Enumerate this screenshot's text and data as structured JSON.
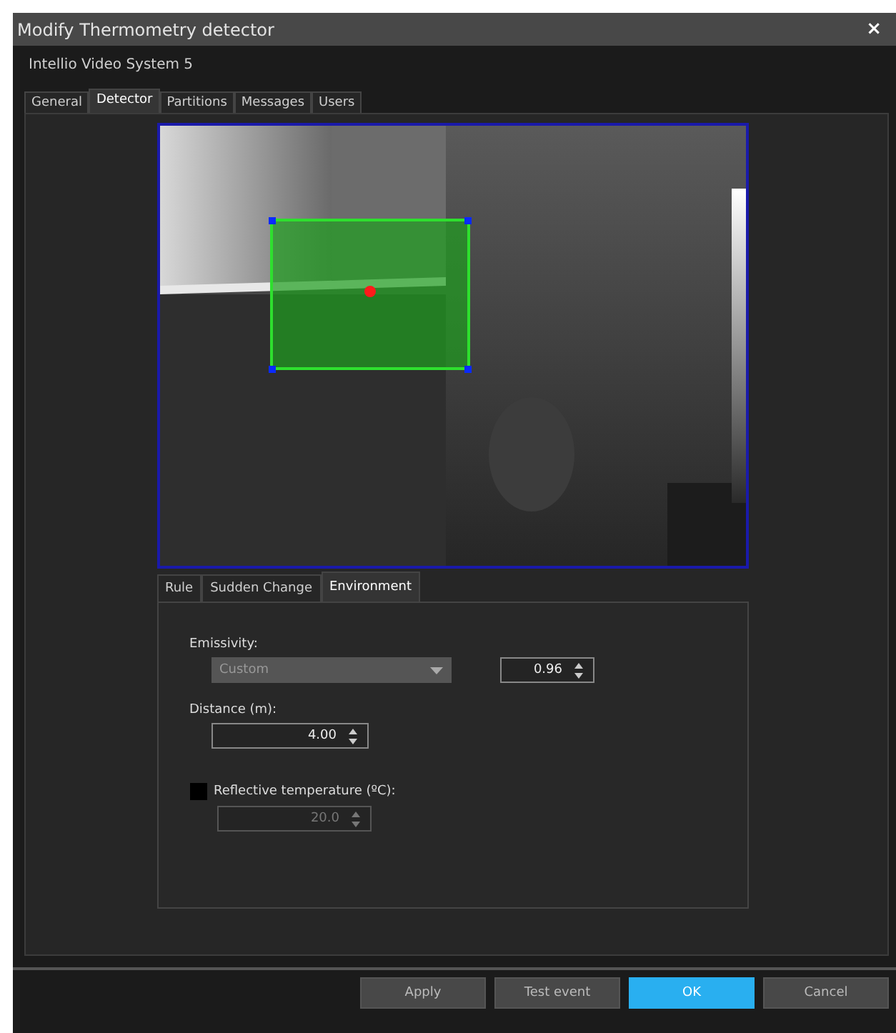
{
  "window": {
    "title": "Modify Thermometry detector",
    "close": "×"
  },
  "system": "Intellio Video System 5",
  "tabs": [
    {
      "label": "General",
      "selected": false
    },
    {
      "label": "Detector",
      "selected": true
    },
    {
      "label": "Partitions",
      "selected": false
    },
    {
      "label": "Messages",
      "selected": false
    },
    {
      "label": "Users",
      "selected": false
    }
  ],
  "subtabs": [
    {
      "label": "Rule",
      "selected": false
    },
    {
      "label": "Sudden Change",
      "selected": false
    },
    {
      "label": "Environment",
      "selected": true
    }
  ],
  "emissivity": {
    "label": "Emissivity:",
    "preset": "Custom",
    "preset_disabled": true,
    "value": "0.96"
  },
  "distance": {
    "label": "Distance (m):",
    "value": "4.00"
  },
  "reflective": {
    "label": "Reflective temperature (ºC):",
    "checked": false,
    "value": "20.0",
    "disabled": true
  },
  "buttons": [
    {
      "label": "Apply",
      "primary": false
    },
    {
      "label": "Test event",
      "primary": false
    },
    {
      "label": "OK",
      "primary": true
    },
    {
      "label": "Cancel",
      "primary": false
    }
  ]
}
